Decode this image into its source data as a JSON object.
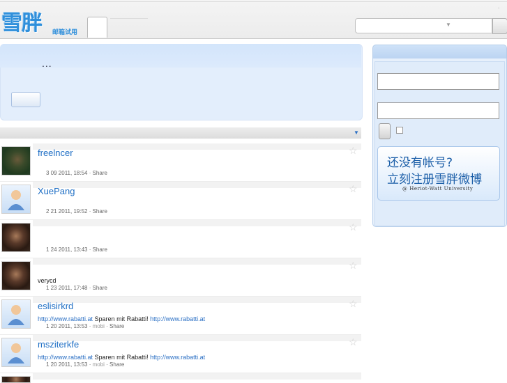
{
  "header": {
    "logo_text": "雪胖",
    "logo_subtitle": "邮箱试用",
    "top_dot": "."
  },
  "publish": {
    "dots": "..."
  },
  "feed": [
    {
      "name": "freelncer",
      "text": "",
      "date": "3 09 2011, 18:54",
      "source": "",
      "action": "Share",
      "avatar": "photo"
    },
    {
      "name": "XuePang",
      "text": "",
      "date": "2 21 2011, 19:52",
      "source": "",
      "action": "Share",
      "avatar": "default"
    },
    {
      "name": "",
      "text": "",
      "date": "1 24 2011, 13:43",
      "source": "",
      "action": "Share",
      "avatar": "dark"
    },
    {
      "name": "",
      "text": "verycd",
      "date": "1 23 2011, 17:48",
      "source": "",
      "action": "Share",
      "avatar": "dark"
    },
    {
      "name": "eslisirkrd",
      "text_link1": "http://www.rabatti.at",
      "text_mid": " Sparen mit Rabatti! ",
      "text_link2": "http://www.rabatti.at",
      "date": "1 20 2011, 13:53",
      "source": "mobi",
      "action": "Share",
      "avatar": "default"
    },
    {
      "name": "msziterkfe",
      "text_link1": "http://www.rabatti.at",
      "text_mid": " Sparen mit Rabatti! ",
      "text_link2": "http://www.rabatti.at",
      "date": "1 20 2011, 13:53",
      "source": "mobi",
      "action": "Share",
      "avatar": "default"
    }
  ],
  "sidebar": {
    "promo_line1": "还没有帐号?",
    "promo_line2": "立刻注册雪胖微博",
    "promo_credit": "@ Heriot-Watt University"
  },
  "colors": {
    "link": "#1f6fc5",
    "panel": "#e3eefc",
    "logo": "#2f8fdb"
  }
}
